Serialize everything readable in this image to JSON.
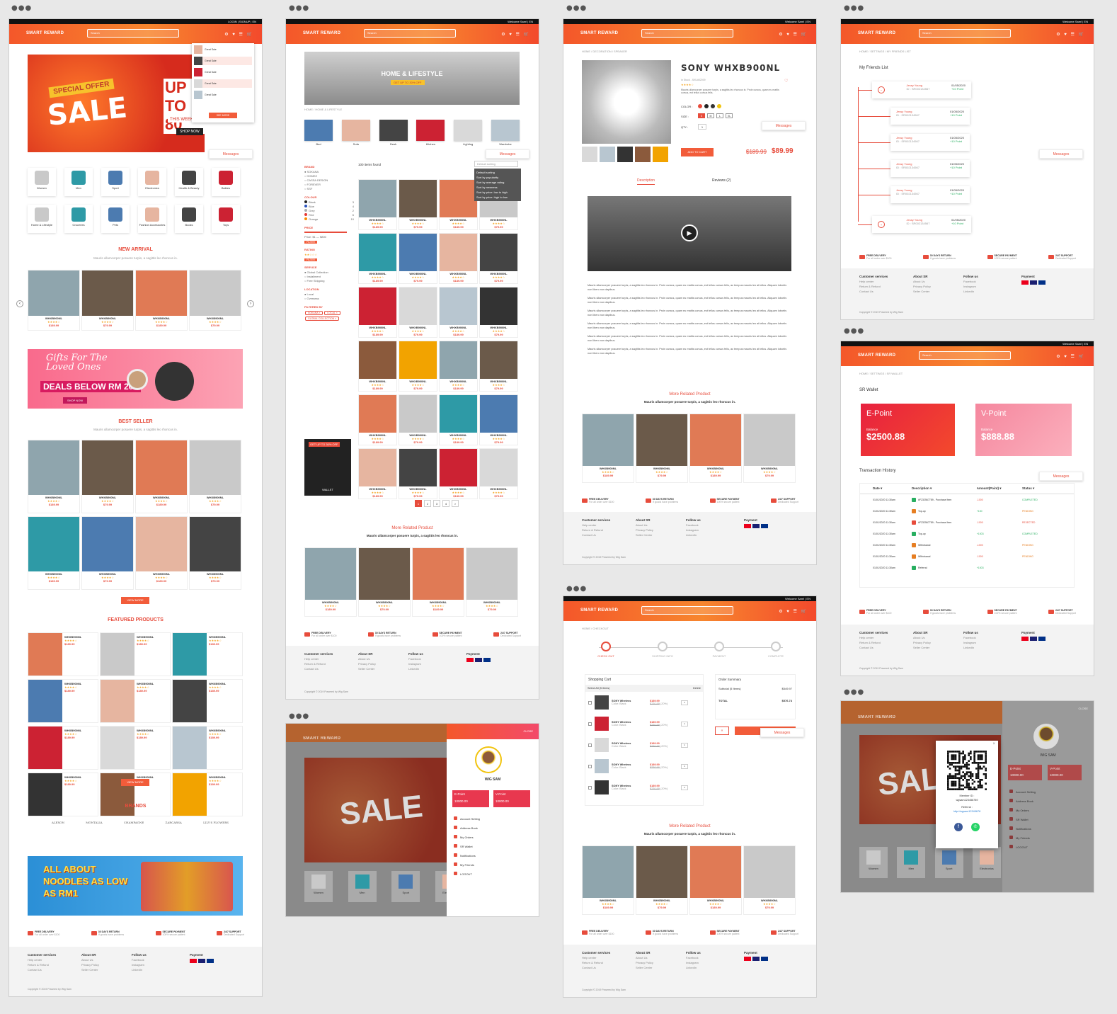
{
  "brand": "SMART REWARD",
  "search_placeholder": "Search",
  "welcome": "Welcome Sam! | EN",
  "login": "LOGIN | SIGNUP | EN",
  "messages": "Messages",
  "categories_row1": [
    "Women",
    "Men",
    "Sport",
    "Electronics",
    "Health & Beauty",
    "Babies"
  ],
  "categories_row2": [
    "Home & Lifestyle",
    "Groceries",
    "Pets",
    "Fashion Accessories",
    "Books",
    "Toys"
  ],
  "home": {
    "sale_tag": "SPECIAL OFFER",
    "sale": "SALE",
    "upto": "UP TO 80",
    "this_week": "THIS WEEK",
    "shop_now": "SHOP NOW",
    "new_arrival": "NEW ARRIVAL",
    "tagline": "Mauris ullamcorper posuere turpis, a sagittis leo rhoncus in.",
    "gift_title": "Gifts For The Loved Ones",
    "gift_deals": "DEALS BELOW RM 200",
    "shop_now_small": "SHOP NOW",
    "best_seller": "BEST SELLER",
    "view_more": "VIEW MORE",
    "featured": "FEATURED PRODUCTS",
    "brands": "BRANDS",
    "brand_names": [
      "ALEXON",
      "MONTALIA",
      "CHAMPAGNE",
      "ZARCARSA",
      "LILY'S FLOWERS"
    ],
    "noodle_title": "ALL ABOUT NOODLES AS LOW AS RM1",
    "dropdown_items": [
      "Great Sale",
      "Great Sale",
      "Great Sale",
      "Great Sale",
      "Great Sale"
    ],
    "dropdown_btn": "SEE MORE"
  },
  "product": {
    "name": "WHXB900NL",
    "price": "$189.99",
    "old_price": "$189.99",
    "sale_price": "$79.99",
    "discount": "-45%"
  },
  "features": [
    {
      "t": "FREE DELIVERY",
      "s": "For all order over $100"
    },
    {
      "t": "30 DAYS RETURN",
      "s": "If goods have problems"
    },
    {
      "t": "SECURE PAYMENT",
      "s": "100% secure patient"
    },
    {
      "t": "24/7 SUPPORT",
      "s": "Dedicated Support"
    }
  ],
  "footer": {
    "col1": {
      "title": "Customer services",
      "items": [
        "Help center",
        "Return & Refund",
        "Contact Us"
      ]
    },
    "col2": {
      "title": "About SR",
      "items": [
        "About Us",
        "Privacy Policy",
        "Seller Center"
      ]
    },
    "col3": {
      "title": "Follow us",
      "items": [
        "Facebook",
        "Instagram",
        "LinkedIn"
      ]
    },
    "col4": {
      "title": "Payment"
    },
    "copyright": "Copyright © 2019 Powered by Wig Sam"
  },
  "listing": {
    "hero": "HOME & LIFESTYLE",
    "hero_sub": "GET UP TO 30% OFF",
    "crumb": "HOME / HOME & LIFESTYLE",
    "subcats": [
      "Bed",
      "Sofa",
      "Desk",
      "Kitchen",
      "Lighting",
      "Wardrobe"
    ],
    "items_found": "100 items found",
    "sort": "Default sorting",
    "sort_opts": [
      "Default sorting",
      "Sort by popularity",
      "Sort by average rating",
      "Sort by newness",
      "Sort by price: low to high",
      "Sort by price: high to low"
    ],
    "brand_h": "BRAND",
    "brands": [
      "SOKANA",
      "HOMEZ",
      "CASSA DESIGN",
      "FOREVER",
      "SSF"
    ],
    "colour_h": "COLOUR",
    "colours": [
      {
        "n": "Black",
        "c": "#222",
        "q": "3"
      },
      {
        "n": "Blue",
        "c": "#2a52be",
        "q": "4"
      },
      {
        "n": "Grey",
        "c": "#aaa",
        "q": "2"
      },
      {
        "n": "Red",
        "c": "#e53935",
        "q": "6"
      },
      {
        "n": "Orange",
        "c": "#fb8c00",
        "q": "10"
      }
    ],
    "price_h": "PRICE",
    "price_range": "Price: $1 — $800",
    "filter": "FILTER",
    "rating_h": "RATING",
    "service_h": "SERVICE",
    "services": [
      "Global Collection",
      "Installment",
      "Free Shipping"
    ],
    "location_h": "LOCATION",
    "locations": [
      "Local",
      "Overseas"
    ],
    "filtered_h": "FILTERED BY",
    "filtered": [
      "SOKANA",
      "LOCAL",
      "GLOBAL COLLECTION"
    ],
    "promo": "GET UP TO 30% OFF",
    "promo_label": "WALLET",
    "pages": [
      "1",
      "2",
      "3",
      "4",
      ">"
    ],
    "related": "More Related Product"
  },
  "detail": {
    "crumb": "HOME / DECORATION / SPEAKER",
    "title": "SONY WHXB900NL",
    "stock": "In Stock - SKU#52009",
    "desc_short": "Mauris ullamcorper posuere turpis, a sagittis leo rhoncus in. Proin cursus, quam eu mattis cursus, est tellus cursus felis.",
    "color": "COLOR :",
    "size": "SIZE :",
    "sizes": [
      "S",
      "M",
      "L",
      "XL"
    ],
    "qty": "QTY :",
    "qty_val": "1",
    "add_cart": "ADD TO CART",
    "old": "$189.99",
    "price": "$89.99",
    "tab1": "Description",
    "tab2": "Reviews (2)",
    "para": "Mauris ullamcorper posuere turpis, a sagittis leo rhoncus in. Proin cursus, quam eu mattis cursus, est tellus cursus felis, ac tempus mauris leo at tellus. Aliquam lobortis non libero non dapibus."
  },
  "checkout": {
    "crumb": "HOME / CHECKOUT",
    "steps": [
      "CHECK OUT",
      "SHIPPING INFO",
      "PAYMENT",
      "COMPLETE"
    ],
    "cart": "Shopping Cart",
    "select_all": "Select All (5 items)",
    "delete": "Delete",
    "item_name": "SONY Wireless",
    "item_color": "Color: Black",
    "item_price": "$189.99",
    "item_old": "$230.99",
    "item_disc": "(-20%)",
    "summary": "Order Summary",
    "subtotal_l": "Subtotal (5 Items)",
    "subtotal": "$549.97",
    "total_l": "TOTAL",
    "total": "$576.74"
  },
  "friends": {
    "crumb": "HOME / SETTINGS / MY FRIENDS LIST",
    "title": "My Friends List",
    "rows": [
      {
        "n": "Jessy Young",
        "id": "ID : SR002134567",
        "d": "01/05/2020",
        "p": "+10 Point"
      }
    ]
  },
  "wallet": {
    "crumb": "HOME / SETTINGS / SR WALLET",
    "title": "SR Wallet",
    "e": "E-Point",
    "ebal_l": "Balance",
    "ebal": "$2500.88",
    "v": "V-Point",
    "vbal_l": "Balance",
    "vbal": "$888.88",
    "history": "Transaction History",
    "cols": [
      "Date",
      "Description",
      "Amount(Point)",
      "Status"
    ],
    "tx": [
      {
        "d": "01/01/2020 11:30am",
        "desc": "#F232567789 - Purchase Item",
        "a": "-1000",
        "s": "COMPLETED",
        "c": "#27ae60"
      },
      {
        "d": "01/01/2020 11:30am",
        "desc": "Top-up",
        "a": "+100",
        "s": "PENDING",
        "c": "#e67e22"
      },
      {
        "d": "01/01/2020 11:30am",
        "desc": "#F232567789 - Purchase Item",
        "a": "-1000",
        "s": "REJECTED",
        "c": "#e74c3c"
      },
      {
        "d": "01/01/2020 11:30am",
        "desc": "Top-up",
        "a": "+1003",
        "s": "COMPLETED",
        "c": "#27ae60"
      },
      {
        "d": "01/01/2020 11:30am",
        "desc": "Withdrawal",
        "a": "-1000",
        "s": "PENDING",
        "c": "#e67e22"
      },
      {
        "d": "01/01/2020 11:30am",
        "desc": "Withdrawal",
        "a": "-1000",
        "s": "PENDING",
        "c": "#e67e22"
      },
      {
        "d": "01/01/2020 11:30am",
        "desc": "Referral",
        "a": "+1003",
        "s": "",
        "c": "#27ae60"
      }
    ]
  },
  "profile": {
    "close": "CLOSE",
    "name": "WIG SAM",
    "e": "E-Point",
    "v": "V-Point",
    "ebal": "10000.00",
    "vbal": "10000.00",
    "menu": [
      "Account Setting",
      "Address Book",
      "My Orders",
      "SR Wallet",
      "Notifications",
      "My Friends",
      "LOGOUT"
    ]
  },
  "qr": {
    "member": "Member ID :",
    "member_id": "wgsam123456789",
    "referral": "Referral :",
    "link": "http://wgsam12345678"
  }
}
